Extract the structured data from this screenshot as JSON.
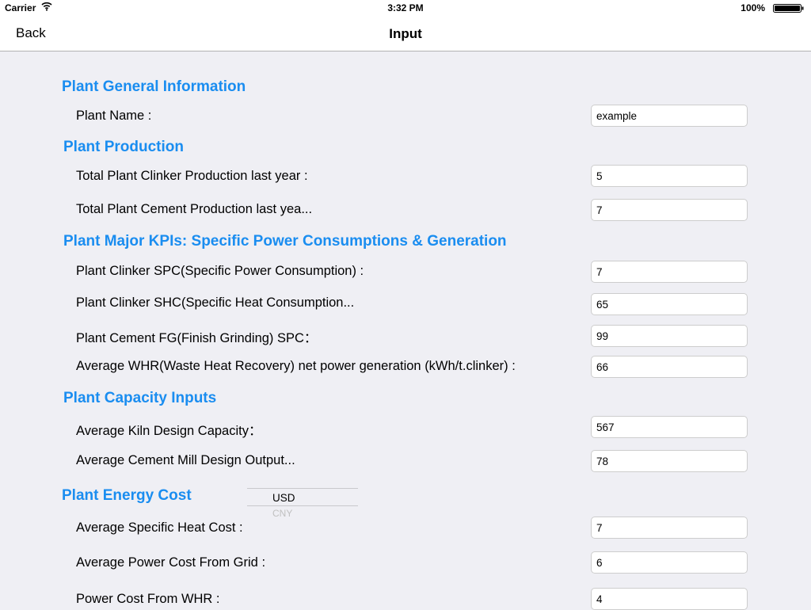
{
  "status_bar": {
    "carrier": "Carrier",
    "wifi_icon": "wifi-icon",
    "time": "3:32 PM",
    "battery_percent": "100%",
    "battery_icon": "battery-icon"
  },
  "nav": {
    "back_label": "Back",
    "title": "Input"
  },
  "sections": {
    "general": {
      "title": "Plant General Information",
      "plant_name_label": "Plant Name :",
      "plant_name_value": "example"
    },
    "production": {
      "title": "Plant Production",
      "clinker_label": "Total Plant Clinker Production last year :",
      "clinker_value": "5",
      "cement_label": "Total Plant Cement  Production last yea...",
      "cement_value": "7"
    },
    "kpis": {
      "title": "Plant Major KPIs: Specific Power Consumptions & Generation",
      "clinker_spc_label": "Plant Clinker SPC(Specific Power Consumption) :",
      "clinker_spc_value": "7",
      "clinker_shc_label": "Plant Clinker SHC(Specific Heat Consumption...",
      "clinker_shc_value": "65",
      "cement_fg_label": "Plant Cement FG(Finish Grinding) SPC：",
      "cement_fg_value": "99",
      "whr_label": "Average WHR(Waste Heat Recovery) net power generation (kWh/t.clinker) :",
      "whr_value": "66"
    },
    "capacity": {
      "title": "Plant Capacity Inputs",
      "kiln_label": "Average Kiln Design Capacity：",
      "kiln_value": "567",
      "mill_label": "Average Cement Mill Design Output...",
      "mill_value": "78"
    },
    "energy": {
      "title": "Plant Energy Cost",
      "currency_selected": "USD",
      "currency_next": "CNY",
      "heat_cost_label": "Average Specific Heat Cost :",
      "heat_cost_value": "7",
      "grid_cost_label": "Average Power Cost From Grid :",
      "grid_cost_value": "6",
      "whr_cost_label": "Power Cost From WHR :",
      "whr_cost_value": "4"
    }
  },
  "colors": {
    "section_title": "#1a8df0",
    "background": "#efeff4"
  }
}
